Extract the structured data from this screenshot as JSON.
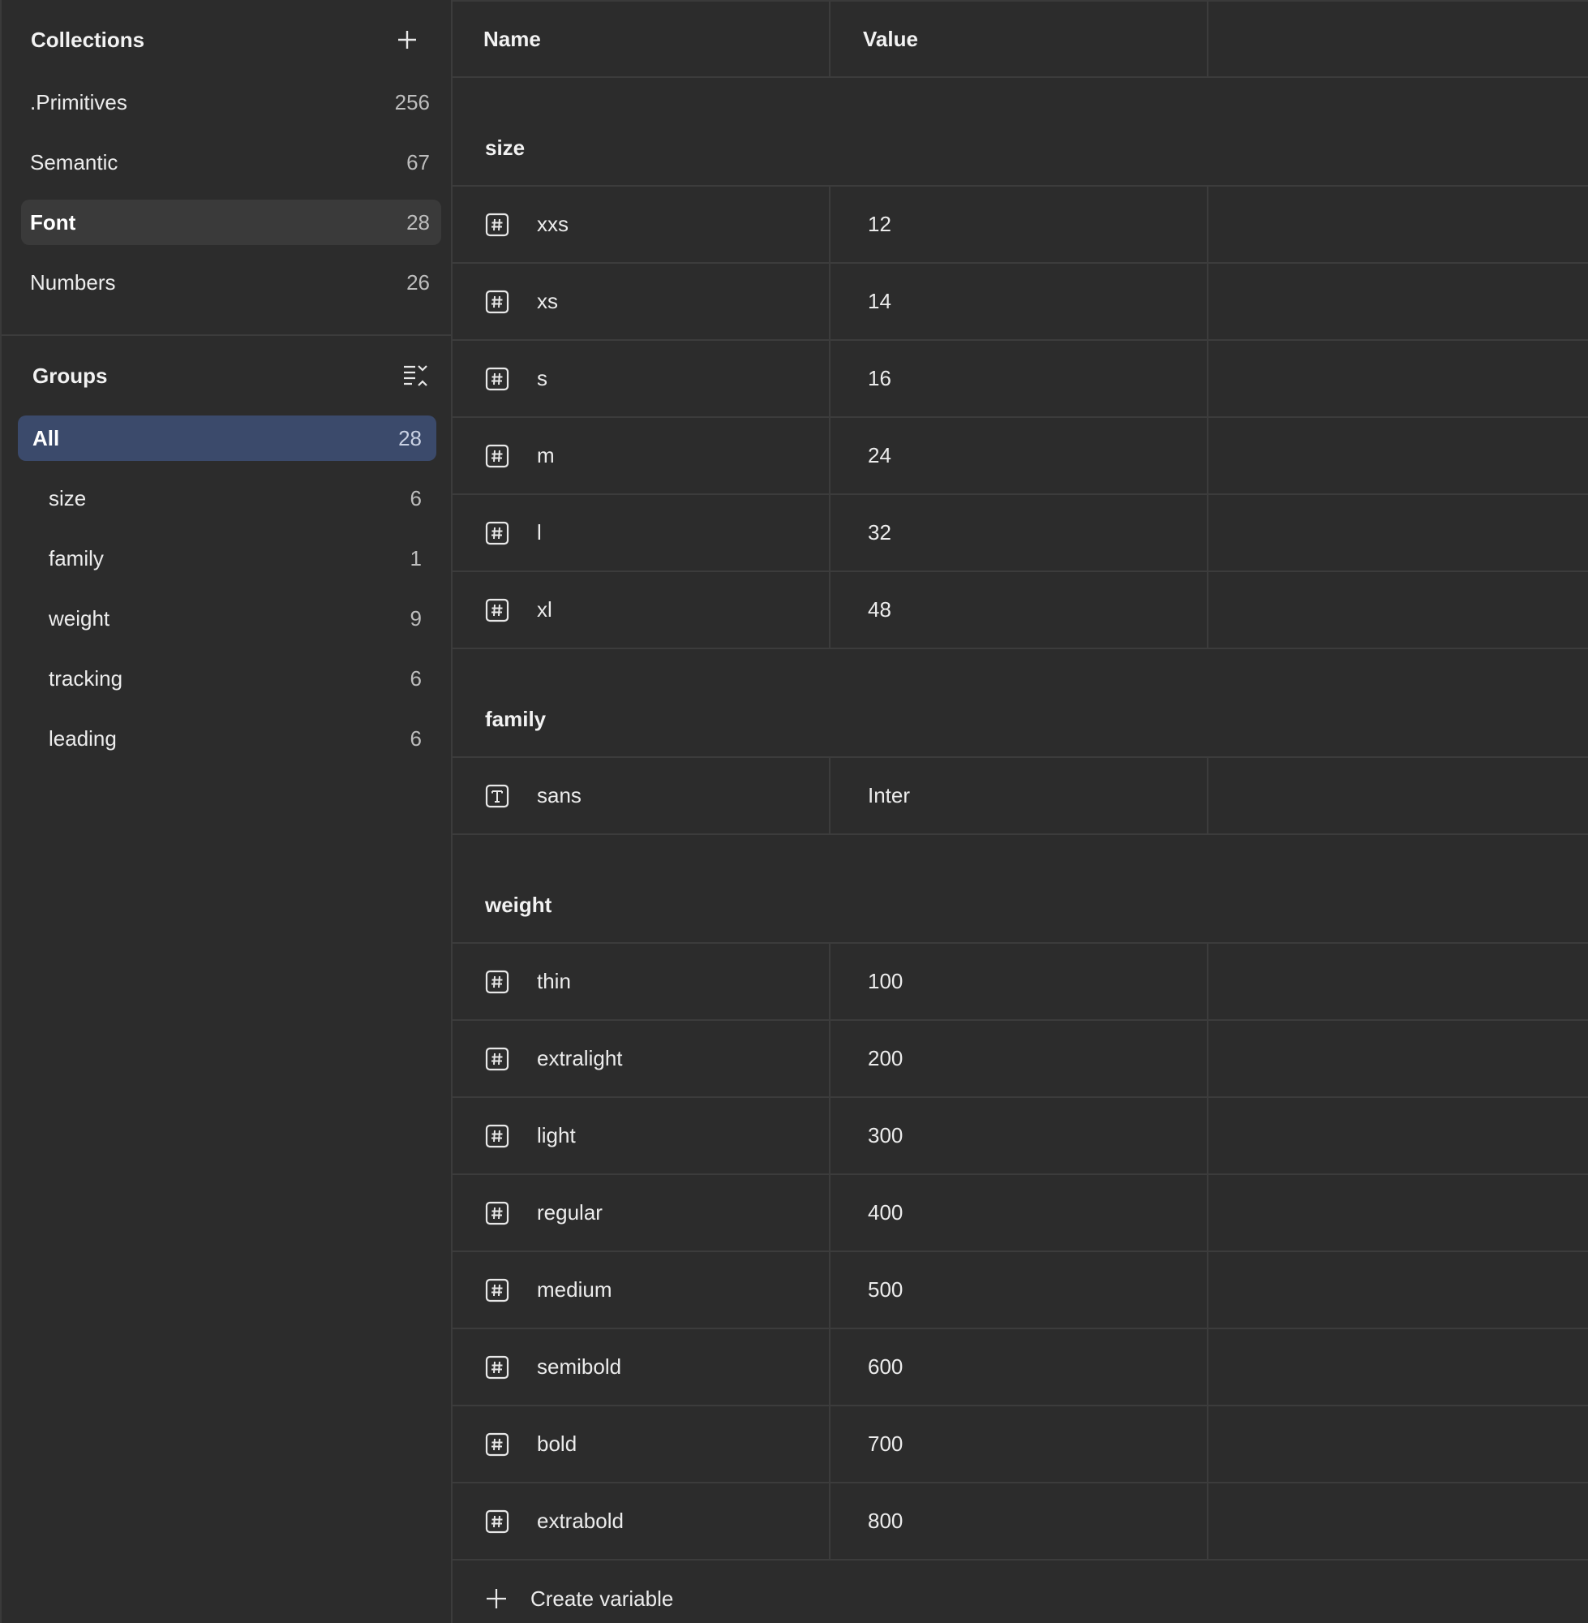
{
  "collections": {
    "title": "Collections",
    "items": [
      {
        "label": ".Primitives",
        "count": "256"
      },
      {
        "label": "Semantic",
        "count": "67"
      },
      {
        "label": "Font",
        "count": "28"
      },
      {
        "label": "Numbers",
        "count": "26"
      }
    ]
  },
  "groups": {
    "title": "Groups",
    "items": [
      {
        "label": "All",
        "count": "28"
      },
      {
        "label": "size",
        "count": "6"
      },
      {
        "label": "family",
        "count": "1"
      },
      {
        "label": "weight",
        "count": "9"
      },
      {
        "label": "tracking",
        "count": "6"
      },
      {
        "label": "leading",
        "count": "6"
      }
    ]
  },
  "table": {
    "headers": {
      "name": "Name",
      "value": "Value"
    },
    "groups": [
      {
        "title": "size",
        "rows": [
          {
            "icon": "number-icon",
            "name": "xxs",
            "value": "12"
          },
          {
            "icon": "number-icon",
            "name": "xs",
            "value": "14"
          },
          {
            "icon": "number-icon",
            "name": "s",
            "value": "16"
          },
          {
            "icon": "number-icon",
            "name": "m",
            "value": "24"
          },
          {
            "icon": "number-icon",
            "name": "l",
            "value": "32"
          },
          {
            "icon": "number-icon",
            "name": "xl",
            "value": "48"
          }
        ]
      },
      {
        "title": "family",
        "rows": [
          {
            "icon": "text-icon",
            "name": "sans",
            "value": "Inter"
          }
        ]
      },
      {
        "title": "weight",
        "rows": [
          {
            "icon": "number-icon",
            "name": "thin",
            "value": "100"
          },
          {
            "icon": "number-icon",
            "name": "extralight",
            "value": "200"
          },
          {
            "icon": "number-icon",
            "name": "light",
            "value": "300"
          },
          {
            "icon": "number-icon",
            "name": "regular",
            "value": "400"
          },
          {
            "icon": "number-icon",
            "name": "medium",
            "value": "500"
          },
          {
            "icon": "number-icon",
            "name": "semibold",
            "value": "600"
          },
          {
            "icon": "number-icon",
            "name": "bold",
            "value": "700"
          },
          {
            "icon": "number-icon",
            "name": "extrabold",
            "value": "800"
          }
        ]
      }
    ],
    "create_label": "Create variable"
  },
  "colors": {
    "background": "#2c2c2c",
    "border": "#3c3c3c",
    "selected_collection": "#3a3a3a",
    "selected_group": "#3b4a6b"
  }
}
